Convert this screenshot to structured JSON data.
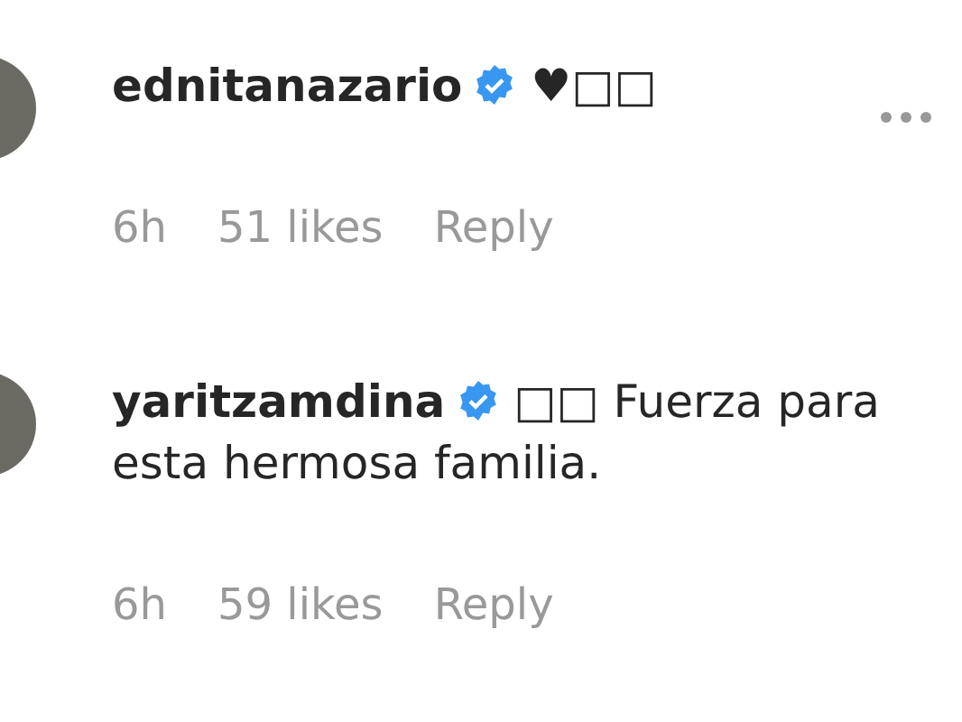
{
  "comments": [
    {
      "username": "ednitanazario",
      "verified": true,
      "text": "♥□□",
      "time": "6h",
      "likes": "51 likes",
      "reply": "Reply",
      "menu": true
    },
    {
      "username": "yaritzamdina",
      "verified": true,
      "text": "□□ Fuerza para esta hermosa familia.",
      "time": "6h",
      "likes": "59 likes",
      "reply": "Reply",
      "menu": false
    }
  ]
}
